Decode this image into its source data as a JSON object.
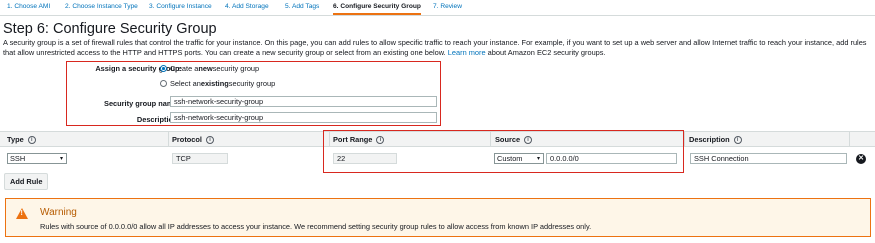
{
  "wizard": {
    "tabs": [
      {
        "label": "1. Choose AMI"
      },
      {
        "label": "2. Choose Instance Type"
      },
      {
        "label": "3. Configure Instance"
      },
      {
        "label": "4. Add Storage"
      },
      {
        "label": "5. Add Tags"
      },
      {
        "label": "6. Configure Security Group"
      },
      {
        "label": "7. Review"
      }
    ],
    "active_index": 5
  },
  "page": {
    "title": "Step 6: Configure Security Group",
    "description": "A security group is a set of firewall rules that control the traffic for your instance. On this page, you can add rules to allow specific traffic to reach your instance. For example, if you want to set up a web server and allow Internet traffic to reach your instance, add rules that allow unrestricted access to the HTTP and HTTPS ports. You can create a new security group or select from an existing one below.",
    "learn_more": "Learn more",
    "description_tail": "about Amazon EC2 security groups."
  },
  "assign": {
    "label": "Assign a security group:",
    "option_new_pre": "Create a ",
    "option_new_bold": "new",
    "option_new_post": " security group",
    "option_existing_pre": "Select an ",
    "option_existing_bold": "existing",
    "option_existing_post": " security group",
    "selected": "new"
  },
  "group": {
    "name_label": "Security group name:",
    "name_value": "ssh-network-security-group",
    "desc_label": "Description:",
    "desc_value": "ssh-network-security-group"
  },
  "table": {
    "headers": {
      "type": "Type",
      "protocol": "Protocol",
      "port_range": "Port Range",
      "source": "Source",
      "description": "Description"
    },
    "info_glyph": "i",
    "rows": [
      {
        "type": "SSH",
        "protocol": "TCP",
        "port_range": "22",
        "source_mode": "Custom",
        "source_cidr": "0.0.0.0/0",
        "description": "SSH Connection"
      }
    ],
    "remove_glyph": "✕"
  },
  "actions": {
    "add_rule": "Add Rule"
  },
  "warning": {
    "icon": "warning-triangle-icon",
    "icon_glyph": "!",
    "title": "Warning",
    "text": "Rules with source of 0.0.0.0/0 allow all IP addresses to access your instance. We recommend setting security group rules to allow access from known IP addresses only."
  },
  "colors": {
    "link": "#0073bb",
    "highlight_box": "#d8281f",
    "warning_accent": "#ec7211",
    "warning_bg": "#fef6e8"
  }
}
